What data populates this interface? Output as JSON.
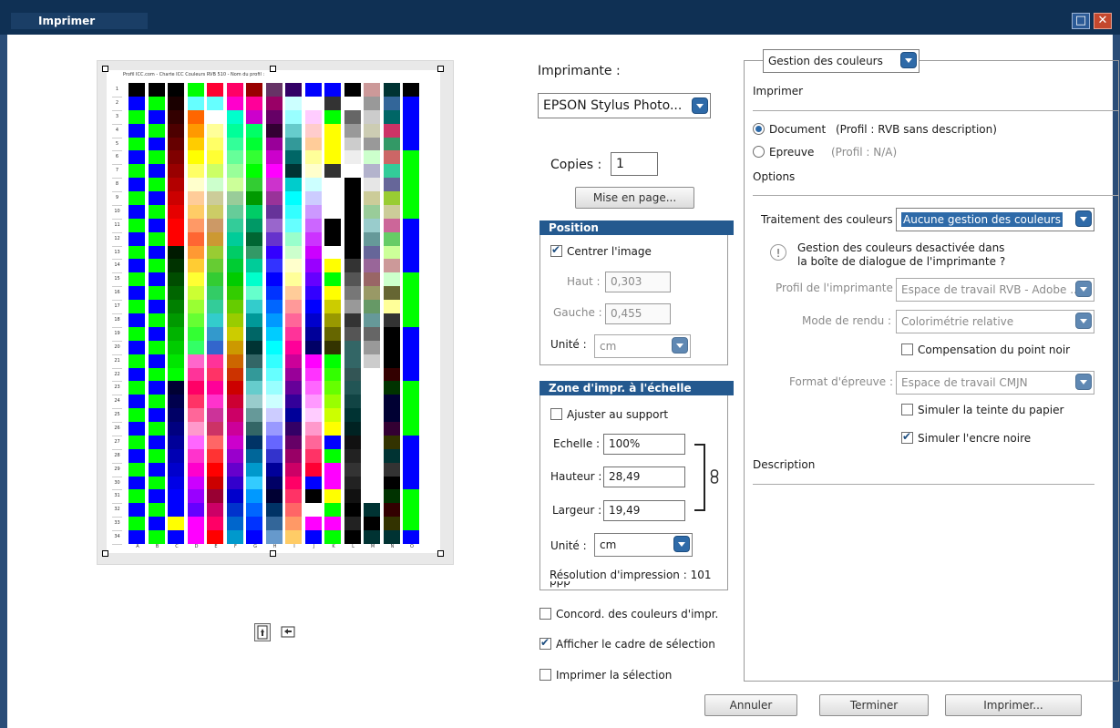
{
  "window": {
    "title": "Imprimer",
    "maximize_glyph": "□",
    "close_glyph": "✕"
  },
  "preview": {
    "chart_header": "Profil ICC.com  -  Charte ICC Couleurs RVB 510  -  Nom du profil :",
    "column_letters": [
      "A",
      "B",
      "C",
      "D",
      "E",
      "F",
      "G",
      "H",
      "I",
      "J",
      "K",
      "L",
      "M",
      "N",
      "O"
    ],
    "row_numbers": [
      "1",
      "2",
      "3",
      "4",
      "5",
      "6",
      "7",
      "8",
      "9",
      "10",
      "11",
      "12",
      "13",
      "14",
      "15",
      "16",
      "17",
      "18",
      "19",
      "20",
      "21",
      "22",
      "23",
      "24",
      "25",
      "26",
      "27",
      "28",
      "29",
      "30",
      "31",
      "32",
      "33",
      "34"
    ],
    "stripe_colors": [
      [
        "#000000",
        "#0000ff",
        "#00ff00",
        "#0000ff",
        "#00ff00",
        "#0000ff",
        "#00ff00",
        "#0000ff",
        "#00ff00",
        "#0000ff",
        "#00ff00",
        "#0000ff",
        "#00ff00",
        "#0000ff",
        "#00ff00",
        "#0000ff",
        "#00ff00",
        "#0000ff",
        "#00ff00",
        "#0000ff",
        "#00ff00",
        "#0000ff",
        "#00ff00",
        "#0000ff",
        "#00ff00",
        "#0000ff",
        "#00ff00",
        "#0000ff",
        "#00ff00",
        "#0000ff",
        "#00ff00",
        "#0000ff",
        "#00ff00",
        "#0000ff"
      ],
      [
        "#000000",
        "#00ff00",
        "#0000ff",
        "#00ff00",
        "#0000ff",
        "#00ff00",
        "#0000ff",
        "#00ff00",
        "#0000ff",
        "#00ff00",
        "#0000ff",
        "#00ff00",
        "#0000ff",
        "#00ff00",
        "#0000ff",
        "#00ff00",
        "#0000ff",
        "#00ff00",
        "#0000ff",
        "#00ff00",
        "#0000ff",
        "#00ff00",
        "#0000ff",
        "#00ff00",
        "#0000ff",
        "#00ff00",
        "#0000ff",
        "#00ff00",
        "#0000ff",
        "#00ff00",
        "#0000ff",
        "#00ff00",
        "#0000ff",
        "#00ff00"
      ],
      [
        "#000000",
        "#1a0000",
        "#330000",
        "#4d0000",
        "#660000",
        "#800000",
        "#990000",
        "#b30000",
        "#cc0000",
        "#e60000",
        "#ff0000",
        "#ff0000",
        "#001a00",
        "#003300",
        "#004d00",
        "#006600",
        "#008000",
        "#009900",
        "#00b300",
        "#00cc00",
        "#00e600",
        "#00ff00",
        "#000033",
        "#00004d",
        "#000066",
        "#000080",
        "#000099",
        "#0000b3",
        "#0000cc",
        "#0000e6",
        "#0000ff",
        "#0000ff",
        "#ffff00",
        "#0000ff"
      ],
      [
        "#00ff00",
        "#66ffff",
        "#ff6600",
        "#ff9900",
        "#ffcc00",
        "#ffff00",
        "#ffff66",
        "#ffffcc",
        "#ffcc99",
        "#ffcc66",
        "#ff9966",
        "#ff6633",
        "#ff9933",
        "#ffcc33",
        "#ffff33",
        "#ccff33",
        "#99ff33",
        "#66ff33",
        "#33ff33",
        "#33ff66",
        "#ff66cc",
        "#ff3399",
        "#ff0066",
        "#ff3366",
        "#ff6699",
        "#ff99cc",
        "#ff66ff",
        "#ff33cc",
        "#ff00cc",
        "#cc00ff",
        "#9900ff",
        "#6600ff",
        "#ff00ff",
        "#ff00ff"
      ],
      [
        "#ff0033",
        "#66ffff",
        "#ffffff",
        "#ffff99",
        "#ffff66",
        "#ffff33",
        "#ccff66",
        "#ccffcc",
        "#cccc99",
        "#cccc66",
        "#cc9966",
        "#cc9933",
        "#99cc33",
        "#66cc33",
        "#33cc33",
        "#33cc66",
        "#33cc99",
        "#33cccc",
        "#3399cc",
        "#3366cc",
        "#ff3399",
        "#ff3366",
        "#ff0099",
        "#ff33cc",
        "#cc3399",
        "#cc3366",
        "#ff6666",
        "#ff3333",
        "#ff0000",
        "#cc0000",
        "#990033",
        "#cc0066",
        "#ff0066",
        "#ff0000"
      ],
      [
        "#ff0066",
        "#ff00cc",
        "#00ffcc",
        "#00ff99",
        "#33ff99",
        "#66ff99",
        "#99ff99",
        "#ccff99",
        "#99cc99",
        "#66cc99",
        "#33cc99",
        "#00cc99",
        "#00cc66",
        "#00cc33",
        "#00cc00",
        "#33cc00",
        "#66cc00",
        "#99cc00",
        "#cccc00",
        "#cc9900",
        "#cc6600",
        "#cc3300",
        "#cc0000",
        "#cc0033",
        "#cc0066",
        "#cc0099",
        "#cc00cc",
        "#9900cc",
        "#6600cc",
        "#3300cc",
        "#0000cc",
        "#0033cc",
        "#0066cc",
        "#0099cc"
      ],
      [
        "#990000",
        "#ff0099",
        "#cc00cc",
        "#00ff66",
        "#00ff33",
        "#33ff33",
        "#00ff00",
        "#33cc33",
        "#009900",
        "#00cc66",
        "#009966",
        "#006633",
        "#339966",
        "#00cc99",
        "#00ffcc",
        "#66ffcc",
        "#33cccc",
        "#009999",
        "#006666",
        "#003333",
        "#336666",
        "#339999",
        "#66cccc",
        "#99cccc",
        "#669999",
        "#336666",
        "#003366",
        "#006699",
        "#0099cc",
        "#33ccff",
        "#0099ff",
        "#0066ff",
        "#0033ff",
        "#0000ff"
      ],
      [
        "#663366",
        "#990066",
        "#660066",
        "#330033",
        "#990099",
        "#cc00cc",
        "#ff00ff",
        "#cc33cc",
        "#993399",
        "#663399",
        "#9966cc",
        "#6633cc",
        "#3300ff",
        "#3333ff",
        "#0000ff",
        "#0033ff",
        "#0066ff",
        "#0099ff",
        "#00ccff",
        "#00ffff",
        "#33ffff",
        "#66ffff",
        "#99ffff",
        "#ccffff",
        "#ccccff",
        "#9999ff",
        "#6666ff",
        "#3333cc",
        "#000099",
        "#000066",
        "#000033",
        "#003366",
        "#336699",
        "#6699cc"
      ],
      [
        "#330066",
        "#ccffff",
        "#99ffff",
        "#66cccc",
        "#339999",
        "#006666",
        "#003333",
        "#00cccc",
        "#00ffff",
        "#33ffff",
        "#66ffff",
        "#99ffcc",
        "#ccffcc",
        "#ffffcc",
        "#ffff99",
        "#ffcc99",
        "#ff9999",
        "#ff6699",
        "#ff3399",
        "#ff0099",
        "#cc0099",
        "#990099",
        "#660099",
        "#330099",
        "#000099",
        "#330066",
        "#660066",
        "#990066",
        "#cc0066",
        "#ff0066",
        "#ff3366",
        "#ff6666",
        "#ff9966",
        "#ffcc66"
      ],
      [
        "#0000ff",
        "#ffffff",
        "#ffccff",
        "#ffcccc",
        "#ffcc99",
        "#ffff99",
        "#ffffcc",
        "#ccffff",
        "#ccccff",
        "#cc99ff",
        "#cc66ff",
        "#cc33ff",
        "#cc00ff",
        "#9900ff",
        "#6600ff",
        "#3300ff",
        "#0000ff",
        "#0000cc",
        "#000099",
        "#000066",
        "#ff00ff",
        "#ff33ff",
        "#ff66ff",
        "#ff99ff",
        "#ffccff",
        "#ff99cc",
        "#ff6699",
        "#ff3366",
        "#ff0033",
        "#0000ff",
        "#000000",
        "#ffffff",
        "#ff00ff",
        "#0000ff"
      ],
      [
        "#0000ff",
        "#333333",
        "#00ff00",
        "#ffff00",
        "#ffff00",
        "#ffff00",
        "#333333",
        "#ffffff",
        "#ffffff",
        "#ffffff",
        "#000000",
        "#000000",
        "#ffffff",
        "#ffff00",
        "#00ff00",
        "#ffff00",
        "#cccc00",
        "#999900",
        "#666600",
        "#333300",
        "#00ff00",
        "#33ff00",
        "#66ff00",
        "#99ff00",
        "#ccff00",
        "#ffff00",
        "#0000ff",
        "#00ff00",
        "#ff00ff",
        "#ff00ff",
        "#ffff00",
        "#00ff00",
        "#ff00ff",
        "#00ff00"
      ],
      [
        "#000000",
        "#ffffff",
        "#666666",
        "#999999",
        "#cccccc",
        "#eeeeee",
        "#ffffff",
        "#000000",
        "#000000",
        "#000000",
        "#000000",
        "#000000",
        "#000000",
        "#333333",
        "#555555",
        "#777777",
        "#999999",
        "#333333",
        "#555555",
        "#336666",
        "#336666",
        "#335555",
        "#225555",
        "#114444",
        "#003333",
        "#002222",
        "#111111",
        "#222222",
        "#333333",
        "#222222",
        "#111111",
        "#000000",
        "#222222",
        "#000000"
      ],
      [
        "#cc9999",
        "#999999",
        "#cccccc",
        "#ccccb3",
        "#999999",
        "#ccffcc",
        "#b3b3cc",
        "#e6e6e6",
        "#cccc99",
        "#99cc99",
        "#99cccc",
        "#669999",
        "#666699",
        "#996699",
        "#996666",
        "#999966",
        "#669966",
        "#669999",
        "#666666",
        "#999999",
        "#cccccc",
        "#ffffff",
        "#ffffff",
        "#ffffff",
        "#ffffff",
        "#ffffff",
        "#ffffff",
        "#ffffff",
        "#ffffff",
        "#ffffff",
        "#ffffff",
        "#003333",
        "#000000",
        "#003333"
      ],
      [
        "#003333",
        "#336699",
        "#006666",
        "#cc3366",
        "#339966",
        "#cc6666",
        "#33cc99",
        "#666699",
        "#99cc33",
        "#cccc99",
        "#cc6699",
        "#66cc66",
        "#ccff99",
        "#cc9999",
        "#ccffcc",
        "#666633",
        "#ffff99",
        "#333333",
        "#000000",
        "#000000",
        "#000000",
        "#330000",
        "#003300",
        "#000033",
        "#000033",
        "#330033",
        "#333300",
        "#003333",
        "#333333",
        "#000000",
        "#003300",
        "#330000",
        "#333300",
        "#003333"
      ],
      [
        "#000000",
        "#0000ff",
        "#0000ff",
        "#0000ff",
        "#0000ff",
        "#00ff00",
        "#00ff00",
        "#00ff00",
        "#00ff00",
        "#00ff00",
        "#0000ff",
        "#0000ff",
        "#0000ff",
        "#0000ff",
        "#00ff00",
        "#00ff00",
        "#00ff00",
        "#00ff00",
        "#0000ff",
        "#0000ff",
        "#0000ff",
        "#0000ff",
        "#00ff00",
        "#00ff00",
        "#00ff00",
        "#00ff00",
        "#0000ff",
        "#0000ff",
        "#0000ff",
        "#0000ff",
        "#00ff00",
        "#00ff00",
        "#00ff00",
        "#0000ff"
      ]
    ]
  },
  "center": {
    "printer_label": "Imprimante :",
    "printer_value": "EPSON Stylus Photo...",
    "copies_label": "Copies :",
    "copies_value": "1",
    "page_setup_button": "Mise en page...",
    "position": {
      "title": "Position",
      "center_image": "Centrer l'image",
      "top_label": "Haut :",
      "top_value": "0,303",
      "left_label": "Gauche :",
      "left_value": "0,455",
      "unit_label": "Unité :",
      "unit_value": "cm"
    },
    "scaled_area": {
      "title": "Zone d'impr. à l'échelle",
      "fit_media": "Ajuster au support",
      "scale_label": "Echelle :",
      "scale_value": "100%",
      "height_label": "Hauteur :",
      "height_value": "28,49",
      "width_label": "Largeur :",
      "width_value": "19,49",
      "unit_label": "Unité :",
      "unit_value": "cm",
      "resolution_text": "Résolution d'impression : 101",
      "resolution_text_cut": "ppp"
    },
    "match_colors": "Concord. des couleurs d'impr.",
    "show_bounding_box": "Afficher le cadre de sélection",
    "print_selection": "Imprimer la sélection"
  },
  "right": {
    "mode_dropdown": "Gestion des couleurs",
    "print_heading": "Imprimer",
    "document_label": "Document",
    "document_profile": "(Profil : RVB sans description)",
    "proof_label": "Epreuve",
    "proof_profile": "(Profil : N/A)",
    "options_heading": "Options",
    "color_handling_label": "Traitement des couleurs :",
    "color_handling_value": "Aucune gestion des couleurs",
    "warning_line1": "Gestion des couleurs desactivée dans",
    "warning_line2": "la boîte de dialogue de l'imprimante ?",
    "printer_profile_label": "Profil de l'imprimante :",
    "printer_profile_value": "Espace de travail RVB - Adobe ...",
    "rendering_intent_label": "Mode de rendu :",
    "rendering_intent_value": "Colorimétrie relative",
    "black_point": "Compensation du point noir",
    "proof_setup_label": "Format d'épreuve :",
    "proof_setup_value": "Espace de travail CMJN",
    "simulate_paper": "Simuler la teinte du papier",
    "simulate_black": "Simuler l'encre noire",
    "description_heading": "Description"
  },
  "footer": {
    "cancel": "Annuler",
    "done": "Terminer",
    "print": "Imprimer..."
  },
  "colors": {
    "title_bar": "#0f3054",
    "group_title": "#24598f",
    "dropdown_button": "#2e6aa8",
    "selection": "#2e6aa8"
  }
}
